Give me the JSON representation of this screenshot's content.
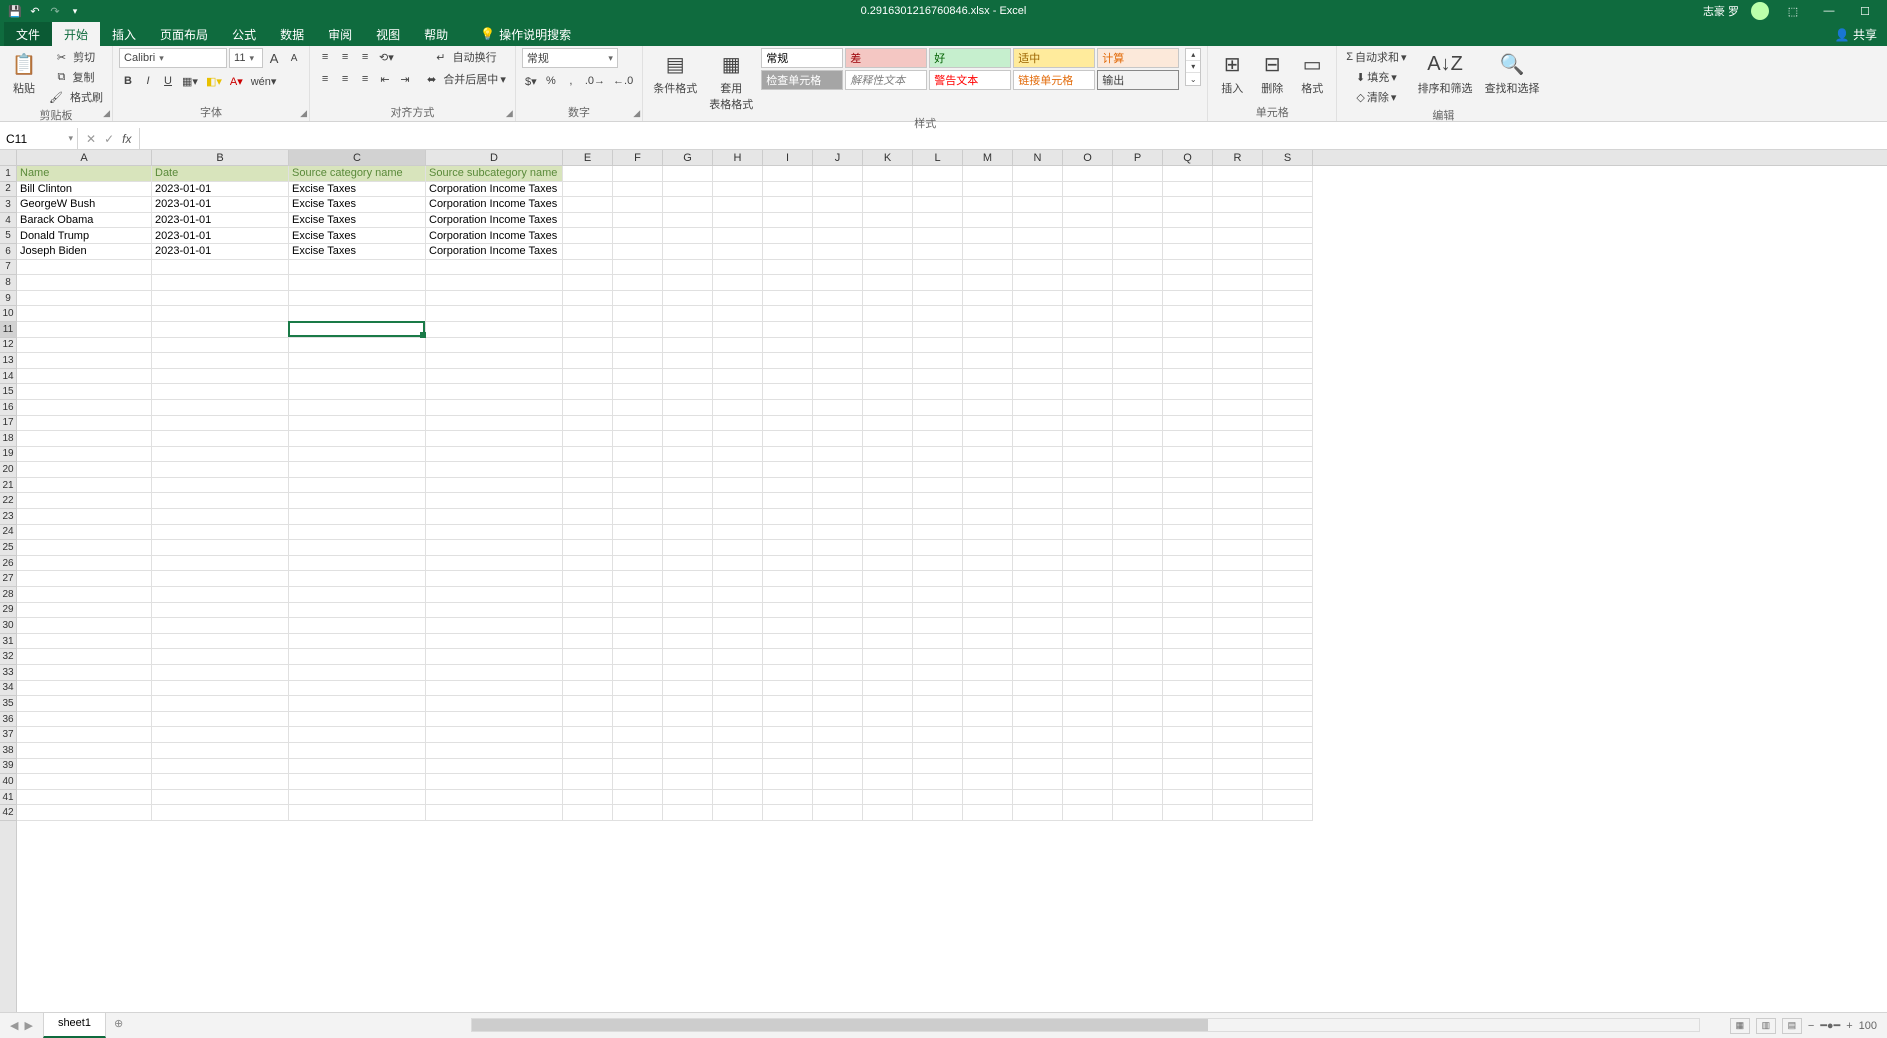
{
  "title": {
    "filename": "0.2916301216760846.xlsx",
    "app": "Excel",
    "separator": " - "
  },
  "user": {
    "name": "志豪 罗"
  },
  "qat": {
    "save": "",
    "undo": "",
    "redo": "",
    "more": ""
  },
  "tabs": {
    "file": "文件",
    "home": "开始",
    "insert": "插入",
    "page_layout": "页面布局",
    "formulas": "公式",
    "data": "数据",
    "review": "审阅",
    "view": "视图",
    "help": "帮助",
    "tellme": "操作说明搜索"
  },
  "share": "共享",
  "clipboard": {
    "label": "剪贴板",
    "paste": "粘贴",
    "cut": "剪切",
    "copy": "复制",
    "format_painter": "格式刷"
  },
  "font": {
    "label": "字体",
    "name": "Calibri",
    "size": "11",
    "increase": "A",
    "decrease": "A"
  },
  "alignment": {
    "label": "对齐方式",
    "wrap": "自动换行",
    "merge": "合并后居中"
  },
  "number": {
    "label": "数字",
    "format": "常规"
  },
  "styles_group": {
    "label": "样式",
    "cond_format": "条件格式",
    "table_format": "套用\n表格格式",
    "gallery": [
      {
        "label": "常规",
        "bg": "#ffffff",
        "fg": "#000"
      },
      {
        "label": "差",
        "bg": "#f4c7c3",
        "fg": "#9c0006"
      },
      {
        "label": "好",
        "bg": "#c6efce",
        "fg": "#006100"
      },
      {
        "label": "适中",
        "bg": "#ffeb9c",
        "fg": "#9c6500"
      },
      {
        "label": "计算",
        "bg": "#fce9da",
        "fg": "#e26b0a"
      },
      {
        "label": "检查单元格",
        "bg": "#a5a5a5",
        "fg": "#ffffff"
      },
      {
        "label": "解释性文本",
        "bg": "#ffffff",
        "fg": "#7f7f7f",
        "italic": true
      },
      {
        "label": "警告文本",
        "bg": "#ffffff",
        "fg": "#ff0000"
      },
      {
        "label": "链接单元格",
        "bg": "#ffffff",
        "fg": "#e26b0a"
      },
      {
        "label": "输出",
        "bg": "#f2f2f2",
        "fg": "#3f3f3f",
        "border": true
      }
    ]
  },
  "cells_group": {
    "label": "单元格",
    "insert": "插入",
    "delete": "删除",
    "format": "格式"
  },
  "editing": {
    "label": "编辑",
    "autosum": "自动求和",
    "fill": "填充",
    "clear": "清除",
    "sort": "排序和筛选",
    "find": "查找和选择"
  },
  "namebox": "C11",
  "formula_value": "",
  "columns": [
    "A",
    "B",
    "C",
    "D",
    "E",
    "F",
    "G",
    "H",
    "I",
    "J",
    "K",
    "L",
    "M",
    "N",
    "O",
    "P",
    "Q",
    "R",
    "S"
  ],
  "col_widths": {
    "A": 135,
    "B": 137,
    "C": 137,
    "D": 137,
    "default": 50
  },
  "row_count": 42,
  "selected_cell": {
    "row": 11,
    "col": "C",
    "col_index": 2
  },
  "sheet": {
    "name": "sheet1"
  },
  "zoom": "100",
  "chart_data": {
    "type": "table",
    "headers": [
      "Name",
      "Date",
      "Source category name",
      "Source subcategory name"
    ],
    "rows": [
      [
        "Bill Clinton",
        "2023-01-01",
        "Excise Taxes",
        "Corporation Income Taxes"
      ],
      [
        "GeorgeW Bush",
        "2023-01-01",
        "Excise Taxes",
        "Corporation Income Taxes"
      ],
      [
        "Barack Obama",
        "2023-01-01",
        "Excise Taxes",
        "Corporation Income Taxes"
      ],
      [
        "Donald Trump",
        "2023-01-01",
        "Excise Taxes",
        "Corporation Income Taxes"
      ],
      [
        "Joseph Biden",
        "2023-01-01",
        "Excise Taxes",
        "Corporation Income Taxes"
      ]
    ]
  }
}
